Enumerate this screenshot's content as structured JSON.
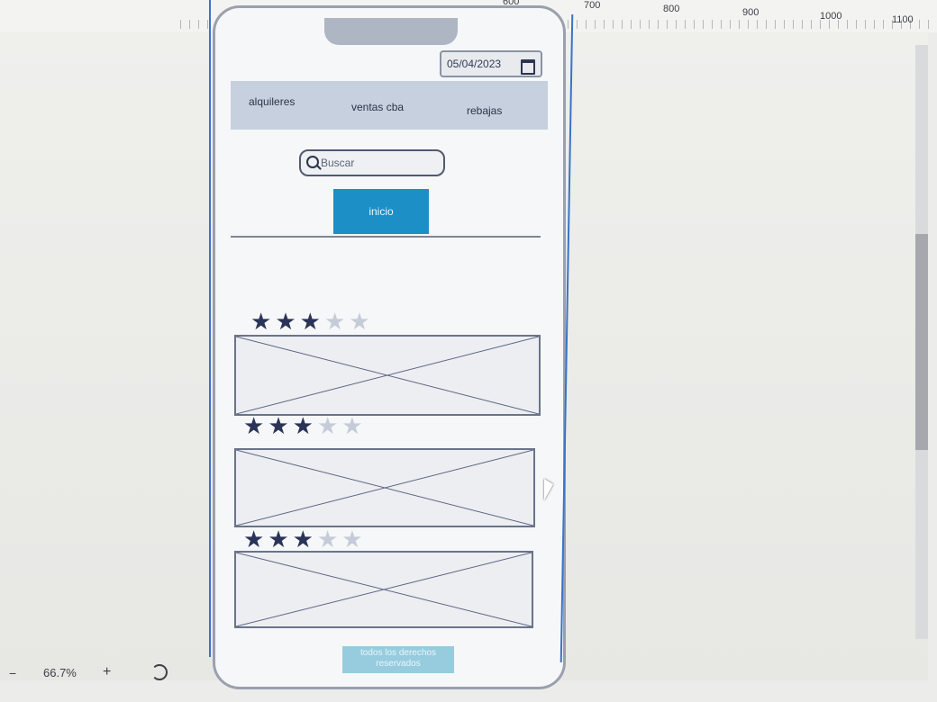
{
  "ruler": {
    "labels": [
      "600",
      "700",
      "800",
      "900",
      "1000",
      "1100"
    ]
  },
  "phone": {
    "date_value": "05/04/2023",
    "nav": [
      "alquileres",
      "ventas cba",
      "rebajas"
    ],
    "search_placeholder": "Buscar",
    "button_label": "inicio",
    "cards": [
      {
        "rating": 3,
        "max": 5
      },
      {
        "rating": 3,
        "max": 5
      },
      {
        "rating": 3,
        "max": 5
      }
    ],
    "bottom_button_label": "todos los derechos reservados"
  },
  "statusbar": {
    "zoom": "66.7%",
    "minus": "−",
    "plus": "+"
  },
  "colors": {
    "primary_button": "#1b8fc6",
    "navbar": "#c7d0de",
    "star_on": "#2a3458",
    "star_off": "#c5ccd8"
  },
  "icons": [
    "search-icon",
    "calendar-icon",
    "undo-icon",
    "cursor-icon"
  ]
}
